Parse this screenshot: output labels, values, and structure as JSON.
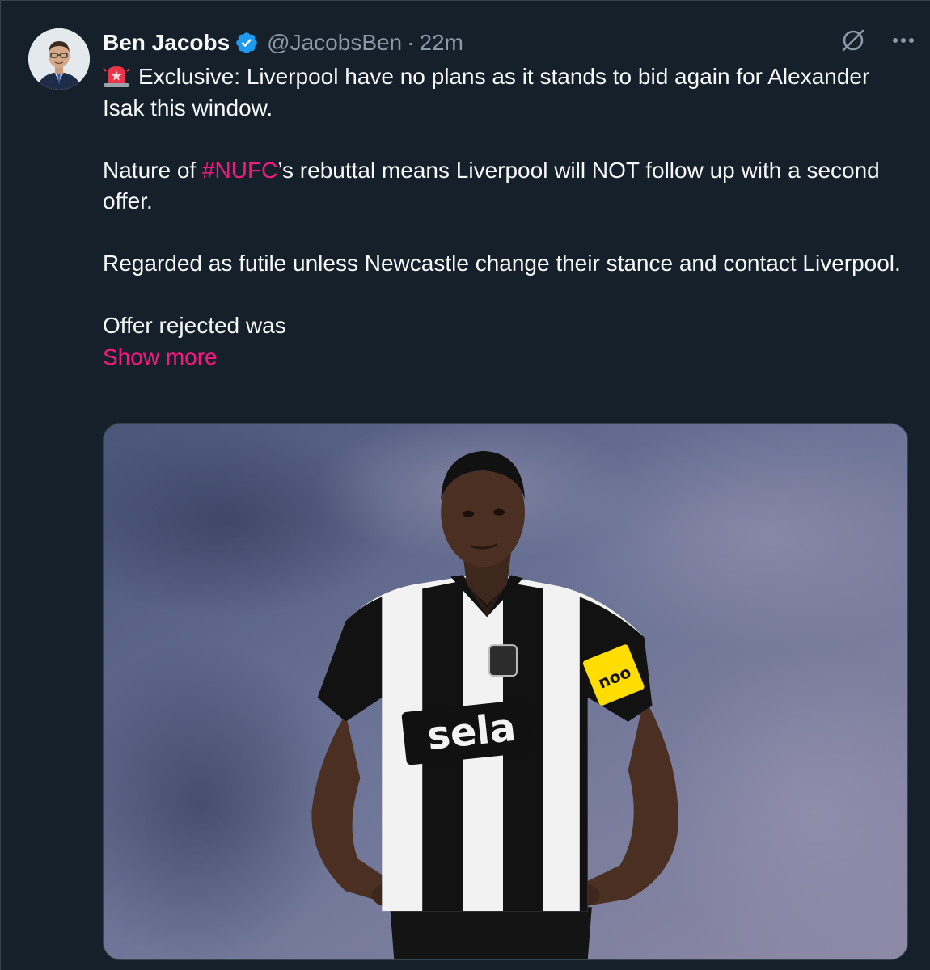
{
  "tweet": {
    "author_name": "Ben Jacobs",
    "handle": "@JacobsBen",
    "separator": "·",
    "time": "22m",
    "icons": {
      "avatar": "avatar",
      "verified": "verified-badge-icon",
      "grok": "grok-icon",
      "more": "more-options-icon",
      "siren": "siren-emoji-icon"
    },
    "paragraph_1": "Exclusive: Liverpool have no plans as it stands to bid again for Alexander Isak this window.",
    "paragraph_2_before": "Nature of ",
    "hashtag": "#NUFC",
    "paragraph_2_after": "’s rebuttal means Liverpool will NOT follow up with a second offer.",
    "paragraph_3": "Regarded as futile unless Newcastle change their stance and contact Liverpool.",
    "paragraph_4": "Offer rejected was",
    "show_more": "Show more",
    "media_shirt_sponsor": "sela",
    "media_armband": "noo"
  },
  "colors": {
    "background": "#15202b",
    "text": "#f7f9f9",
    "secondary": "#8b98a5",
    "accent": "#f91880",
    "verified": "#1d9bf0"
  }
}
